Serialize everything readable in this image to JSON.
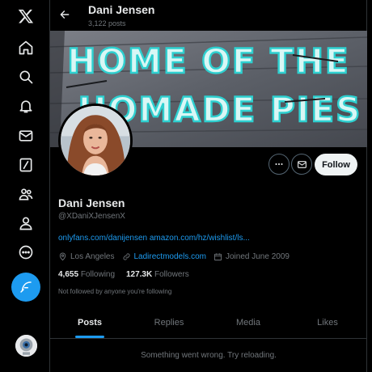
{
  "sidebar": {
    "items": [
      {
        "name": "x-logo-icon"
      },
      {
        "name": "home-icon"
      },
      {
        "name": "search-icon"
      },
      {
        "name": "bell-icon"
      },
      {
        "name": "mail-icon"
      },
      {
        "name": "grok-icon"
      },
      {
        "name": "communities-icon"
      },
      {
        "name": "profile-icon"
      },
      {
        "name": "more-icon"
      }
    ],
    "compose_icon": "feather-icon"
  },
  "header": {
    "name": "Dani Jensen",
    "posts_count": "3,122 posts"
  },
  "banner": {
    "sign_line1": "HOME OF THE",
    "sign_line2": "HOMADE PIES"
  },
  "profile": {
    "name": "Dani Jensen",
    "handle": "@XDaniXJensenX",
    "bio_links": "onlyfans.com/danijensen amazon.com/hz/wishlist/ls...",
    "location": "Los Angeles",
    "website": "Ladirectmodels.com",
    "joined": "Joined June 2009",
    "following_count": "4,655",
    "following_label": "Following",
    "followers_count": "127.3K",
    "followers_label": "Followers",
    "followed_by_note": "Not followed by anyone you're following"
  },
  "actions": {
    "follow_label": "Follow"
  },
  "tabs": [
    {
      "label": "Posts",
      "active": true
    },
    {
      "label": "Replies",
      "active": false
    },
    {
      "label": "Media",
      "active": false
    },
    {
      "label": "Likes",
      "active": false
    }
  ],
  "feed": {
    "error_text": "Something went wrong. Try reloading."
  },
  "colors": {
    "accent": "#1d9bf0",
    "background": "#000000",
    "text": "#e7e9ea",
    "muted": "#71767b"
  }
}
